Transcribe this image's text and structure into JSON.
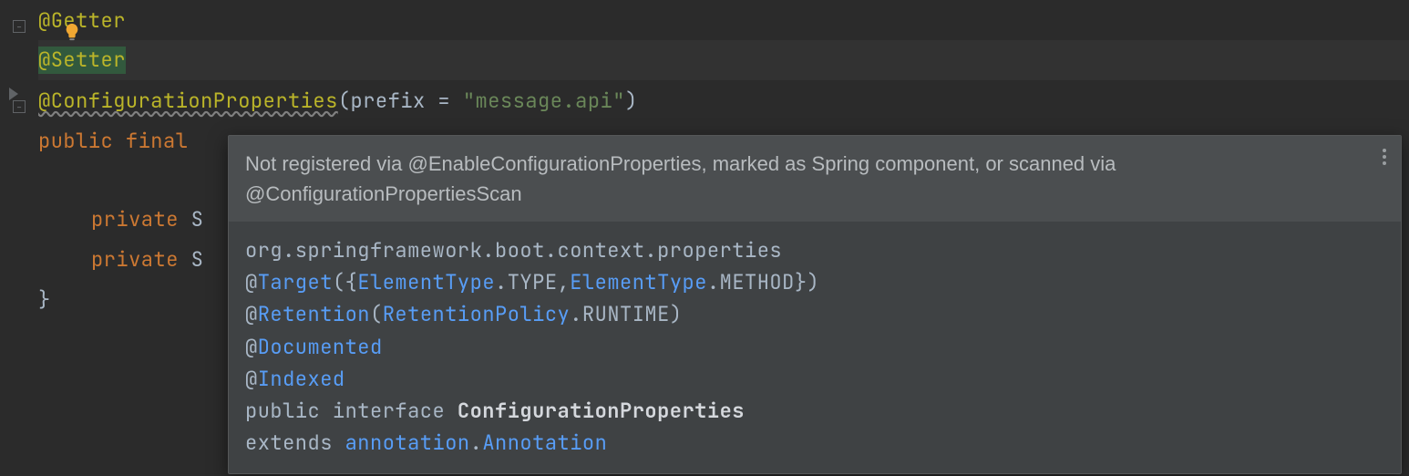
{
  "code": {
    "line1_ann": "@Getter",
    "line2_ann": "@Setter",
    "line3_ann": "@ConfigurationProperties",
    "line3_open": "(prefix = ",
    "line3_str": "\"message.api\"",
    "line3_close": ")",
    "line4_kw": "public final ",
    "line5_pre": "    ",
    "line5_kw": "private ",
    "line5_type": "S",
    "line6_pre": "    ",
    "line6_kw": "private ",
    "line6_type": "S",
    "line7": "}"
  },
  "popup": {
    "warning": "Not registered via @EnableConfigurationProperties, marked as Spring component, or scanned via @ConfigurationPropertiesScan",
    "pkg": "org.springframework.boot.context.properties",
    "l2_at": "@",
    "l2_a": "Target",
    "l2_b": "({",
    "l2_c1": "ElementType",
    "l2_d1": ".TYPE,",
    "l2_c2": "ElementType",
    "l2_d2": ".METHOD})",
    "l3_at": "@",
    "l3_a": "Retention",
    "l3_b": "(",
    "l3_c": "RetentionPolicy",
    "l3_d": ".RUNTIME)",
    "l4_at": "@",
    "l4_a": "Documented",
    "l5_at": "@",
    "l5_a": "Indexed",
    "l6_a": "public interface ",
    "l6_b": "ConfigurationProperties",
    "l7_a": "extends ",
    "l7_b": "annotation",
    "l7_c": ".",
    "l7_d": "Annotation"
  }
}
